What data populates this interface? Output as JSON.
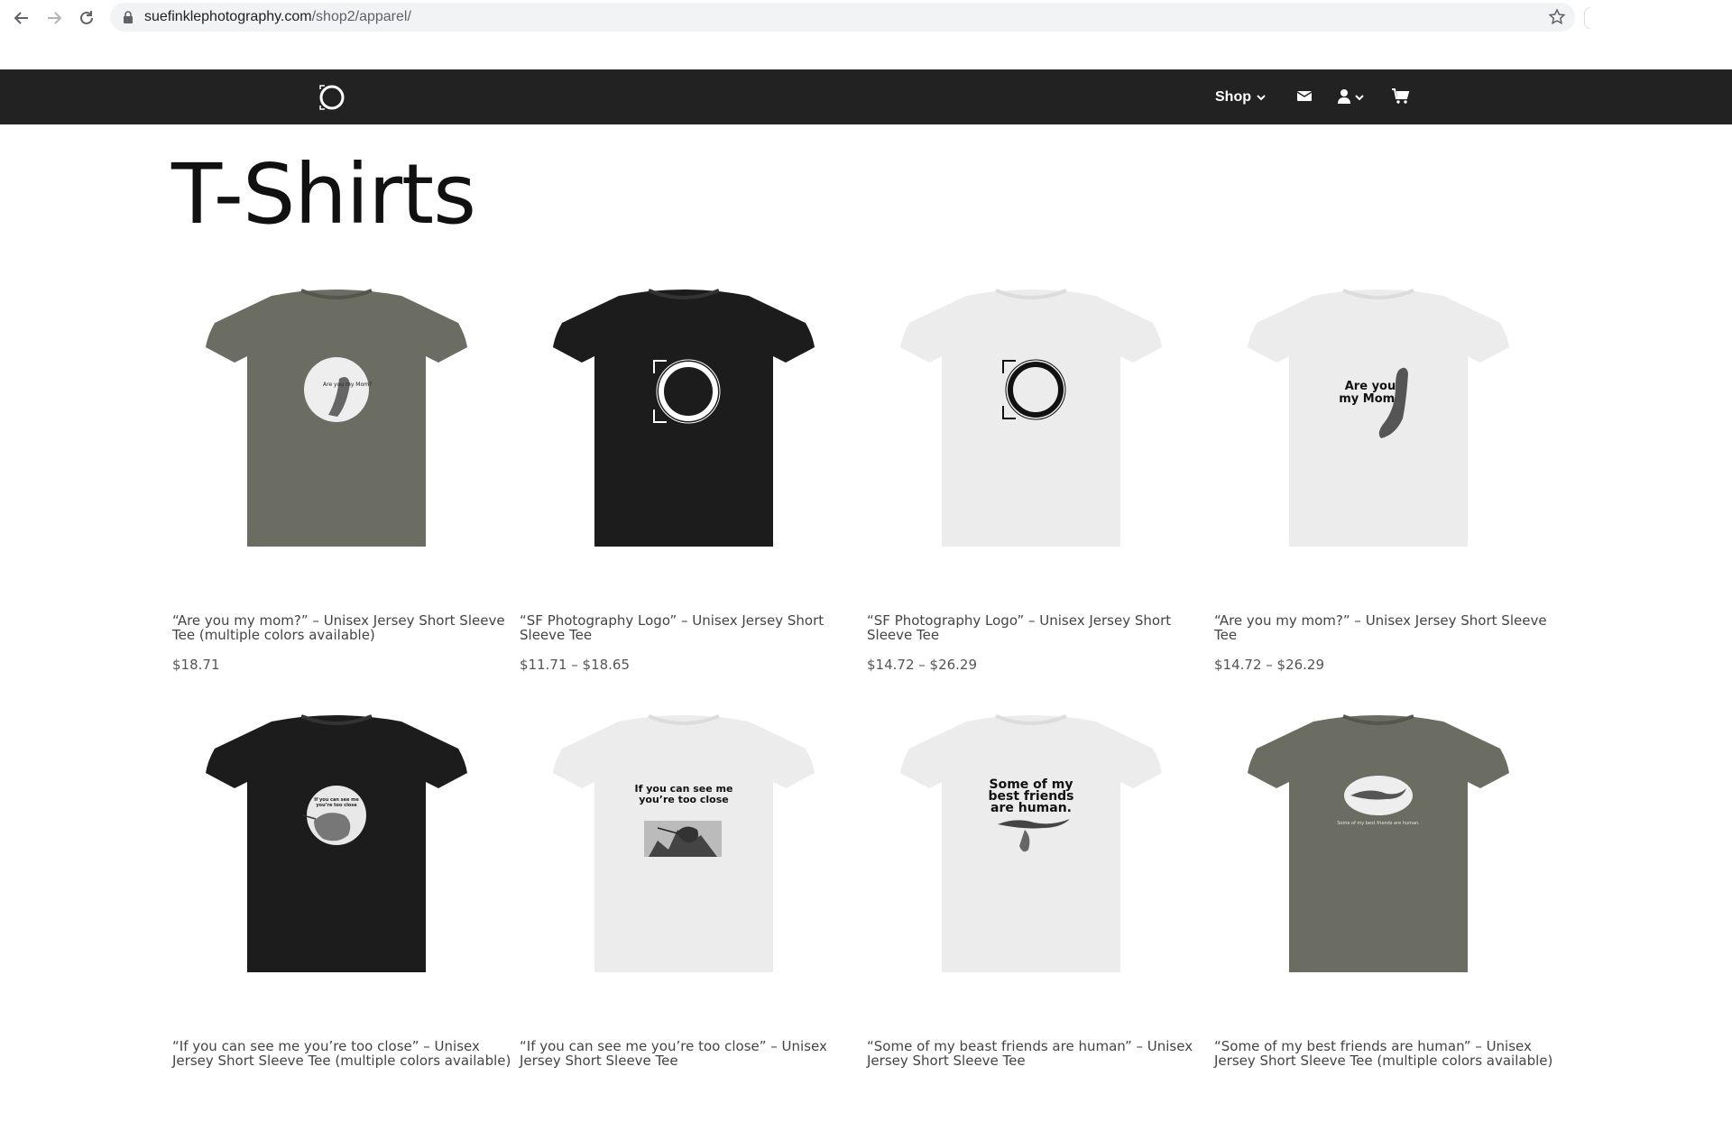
{
  "browser": {
    "url_domain": "suefinklephotography.com",
    "url_path": "/shop2/apparel/"
  },
  "header": {
    "shop_label": "Shop"
  },
  "page": {
    "title": "T-Shirts"
  },
  "colors": {
    "header_bg": "#222222",
    "shirt_army": "#6b6c62",
    "shirt_black": "#1c1c1c",
    "shirt_white": "#ececec"
  },
  "products": [
    {
      "name": "“Are you my mom?” – Unisex Jersey Short Sleeve Tee (multiple colors available)",
      "price": "$18.71",
      "shirt_color": "army",
      "print": "circle-photo"
    },
    {
      "name": "“SF Photography Logo” – Unisex Jersey Short Sleeve Tee",
      "price": "$11.71 – $18.65",
      "shirt_color": "black",
      "print": "logo-light"
    },
    {
      "name": "“SF Photography Logo” – Unisex Jersey Short Sleeve Tee",
      "price": "$14.72 – $26.29",
      "shirt_color": "white",
      "print": "logo-dark"
    },
    {
      "name": "“Are you my mom?” – Unisex Jersey Short Sleeve Tee",
      "price": "$14.72 – $26.29",
      "shirt_color": "white",
      "print": "text-bird"
    },
    {
      "name": "“If you can see me you’re too close” – Unisex Jersey Short Sleeve Tee (multiple colors available)",
      "price": "",
      "shirt_color": "black",
      "print": "circle-photo"
    },
    {
      "name": "“If you can see me you’re too close” – Unisex Jersey Short Sleeve Tee",
      "price": "",
      "shirt_color": "white",
      "print": "text-photo"
    },
    {
      "name": "“Some of my beast friends are human” – Unisex Jersey Short Sleeve Tee",
      "price": "",
      "shirt_color": "white",
      "print": "text-bird-big"
    },
    {
      "name": "“Some of my best friends are human” – Unisex Jersey Short Sleeve Tee (multiple colors available)",
      "price": "",
      "shirt_color": "army",
      "print": "oval-photo"
    }
  ],
  "print_texts": {
    "p4": [
      "Are you",
      "my Mom?"
    ],
    "p6": [
      "If you can see me",
      "you’re too close"
    ],
    "p7": [
      "Some of my",
      "best friends",
      "are human."
    ]
  }
}
